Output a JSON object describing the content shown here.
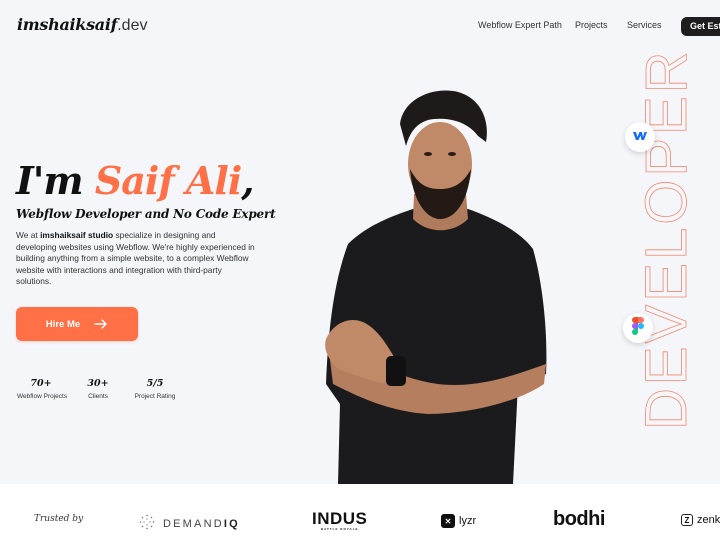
{
  "nav": {
    "logo_bold": "imshaiksaif",
    "logo_tld": ".dev",
    "links": [
      "Webflow Expert Path",
      "Projects",
      "Services"
    ],
    "cta_label": "Get Estimate"
  },
  "hero": {
    "title_prefix": "I'm ",
    "title_name": "Saif Ali",
    "title_suffix": ",",
    "subtitle": "Webflow Developer and No Code Expert",
    "desc_prefix": "We at ",
    "desc_bold": "imshaiksaif studio",
    "desc_rest": " specialize in designing and developing websites using Webflow. We're highly experienced in building anything from a simple website, to a complex Webflow website with interactions and integration with third-party solutions.",
    "hire_label": "Hire Me",
    "hire_icon": "arrow-right-icon",
    "stats": [
      {
        "value": "70+",
        "label": "Webflow Projects"
      },
      {
        "value": "30+",
        "label": "Clients"
      },
      {
        "value": "5/5",
        "label": "Project Rating"
      }
    ],
    "vertical_word": "DEVELOPER",
    "badges": [
      "webflow-icon",
      "figma-icon"
    ]
  },
  "trusted": {
    "label": "Trusted by",
    "brands": [
      {
        "name": "DEMAND",
        "suffix": "IQ"
      },
      {
        "name": "INDUS",
        "tagline": "BATTLE ROYALE"
      },
      {
        "name": "lyzr"
      },
      {
        "name": "bodhi"
      },
      {
        "name": "zenk"
      }
    ]
  },
  "colors": {
    "accent": "#ff7047",
    "dark": "#1e1e1e",
    "background": "#f5f6fa"
  }
}
